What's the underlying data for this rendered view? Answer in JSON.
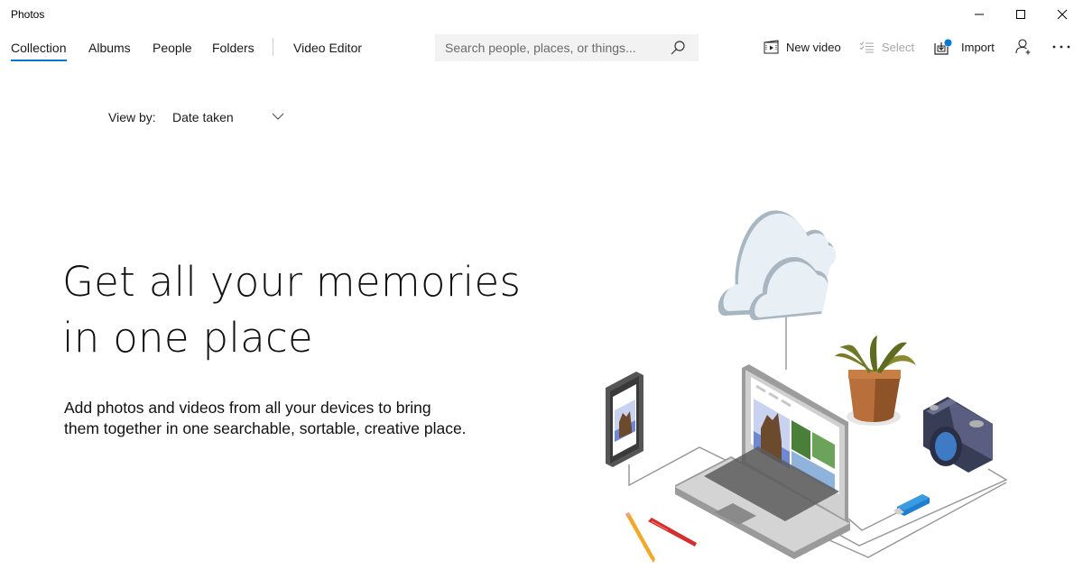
{
  "window": {
    "title": "Photos",
    "controls": {
      "minimize": "minimize",
      "maximize": "maximize",
      "close": "close"
    }
  },
  "nav": {
    "tabs": [
      {
        "label": "Collection",
        "active": true
      },
      {
        "label": "Albums",
        "active": false
      },
      {
        "label": "People",
        "active": false
      },
      {
        "label": "Folders",
        "active": false
      },
      {
        "label": "Video Editor",
        "active": false
      }
    ],
    "accent_color": "#0078d4"
  },
  "search": {
    "value": "",
    "placeholder": "Search people, places, or things...",
    "icon": "search-icon"
  },
  "toolbar": {
    "new_video": {
      "label": "New video",
      "icon": "film-icon"
    },
    "select": {
      "label": "Select",
      "icon": "checklist-icon",
      "enabled": false
    },
    "import": {
      "label": "Import",
      "icon": "import-icon",
      "badge_color": "#0078d4"
    },
    "account": {
      "icon": "add-person-icon"
    },
    "more": {
      "icon": "more-icon"
    }
  },
  "view_by": {
    "label": "View by:",
    "selected": "Date taken"
  },
  "empty_state": {
    "title_line1": "Get all your memories",
    "title_line2": "in one place",
    "description_line1": "Add photos and videos from all your devices to bring",
    "description_line2": "them together in one searchable, sortable, creative place."
  }
}
